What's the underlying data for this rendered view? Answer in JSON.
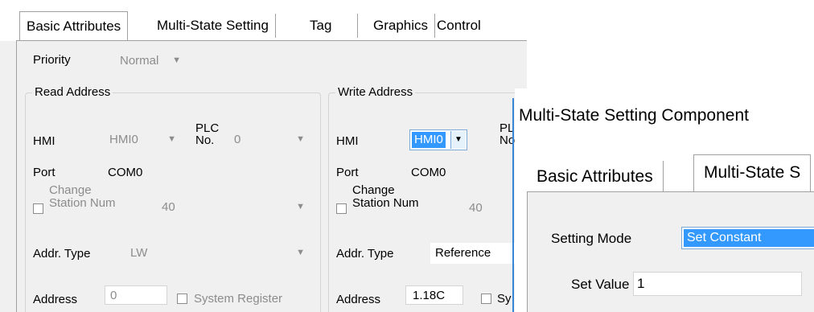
{
  "tabs": [
    "Basic Attributes",
    "Multi-State Setting",
    "Tag",
    "Graphics",
    "Control"
  ],
  "priority": {
    "label": "Priority",
    "value": "Normal"
  },
  "read": {
    "title": "Read Address",
    "hmi_label": "HMI",
    "hmi_value": "HMI0",
    "plc_label_1": "PLC",
    "plc_label_2": "No.",
    "plc_value": "0",
    "port_label": "Port",
    "port_value": "COM0",
    "change_station_1": "Change",
    "change_station_2": "Station Num",
    "station_value": "40",
    "addr_type_label": "Addr. Type",
    "addr_type_value": "LW",
    "address_label": "Address",
    "address_value": "0",
    "system_register": "System Register"
  },
  "write": {
    "title": "Write Address",
    "hmi_label": "HMI",
    "hmi_value": "HMI0",
    "plc_label_1": "PL",
    "plc_label_2": "No",
    "port_label": "Port",
    "port_value": "COM0",
    "change_station_1": "Change",
    "change_station_2": "Station Num",
    "station_value": "40",
    "addr_type_label": "Addr. Type",
    "addr_type_value": "Reference",
    "address_label": "Address",
    "address_value": "1.18C",
    "system_register": "Sy"
  },
  "component": {
    "title": "Multi-State Setting Component",
    "tabs": [
      "Basic Attributes",
      "Multi-State S"
    ],
    "setting_mode_label": "Setting Mode",
    "setting_mode_value": "Set Constant",
    "set_value_label": "Set Value",
    "set_value": "1"
  }
}
